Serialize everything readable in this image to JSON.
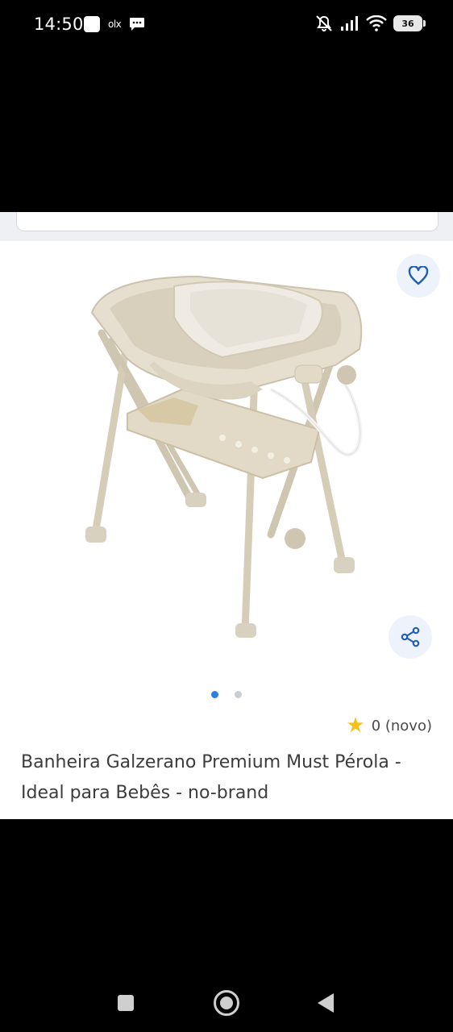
{
  "status_bar": {
    "time": "14:50",
    "app_badge": "olx",
    "battery": "36"
  },
  "product": {
    "title": "Banheira Galzerano Premium Must Pérola - Ideal para Bebês - no-brand",
    "rating_text": "0 (novo)",
    "image_count": 2,
    "active_image": 1
  },
  "icons": {
    "favorite": "heart-icon",
    "share": "share-icon",
    "rating": "star-icon"
  },
  "colors": {
    "accent": "#2b7fe0",
    "star": "#f2c21b",
    "button_bg": "#eef3fb"
  }
}
